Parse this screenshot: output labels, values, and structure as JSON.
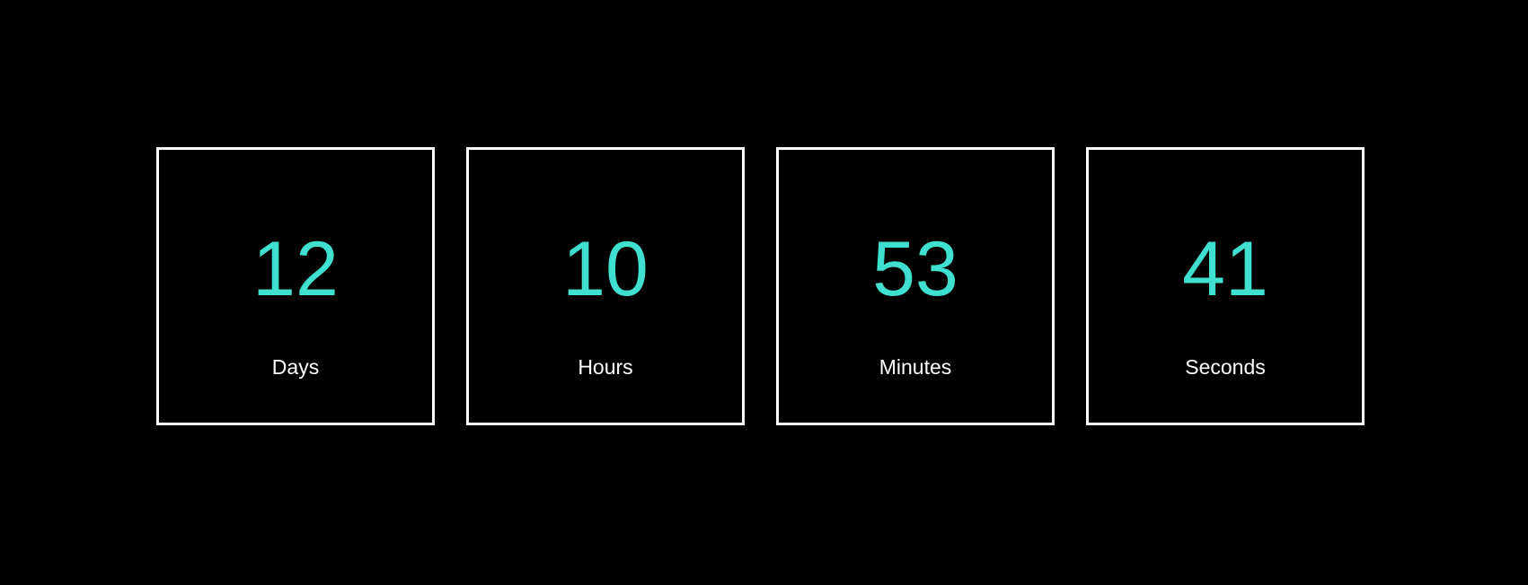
{
  "colors": {
    "background": "#000000",
    "tile_border": "#ffffff",
    "value": "#40e0d0",
    "label": "#ffffff"
  },
  "countdown": {
    "days": {
      "value": "12",
      "label": "Days"
    },
    "hours": {
      "value": "10",
      "label": "Hours"
    },
    "minutes": {
      "value": "53",
      "label": "Minutes"
    },
    "seconds": {
      "value": "41",
      "label": "Seconds"
    }
  }
}
